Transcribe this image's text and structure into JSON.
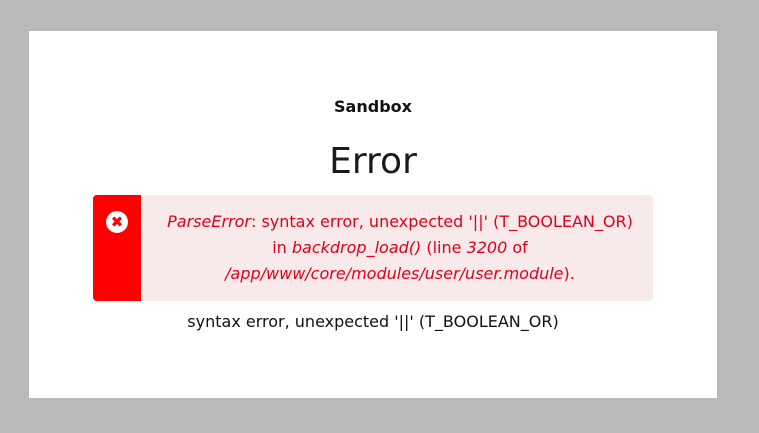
{
  "site": {
    "name": "Sandbox"
  },
  "page": {
    "title": "Error"
  },
  "error_message": {
    "icon": "error-x-circle-icon",
    "exception_type": "ParseError",
    "text_1": ": syntax error, unexpected '||' (T_BOOLEAN_OR) in ",
    "function": "backdrop_load()",
    "text_2": " (line ",
    "line": "3200",
    "text_3": " of ",
    "file": "/app/www/core/modules/user/user.module",
    "text_4": ")."
  },
  "error_summary": "syntax error, unexpected '||' (T_BOOLEAN_OR)",
  "colors": {
    "background": "#b9b9b9",
    "error_bar": "#ff0000",
    "error_box": "#f8eaea",
    "error_text": "#e0001a"
  }
}
